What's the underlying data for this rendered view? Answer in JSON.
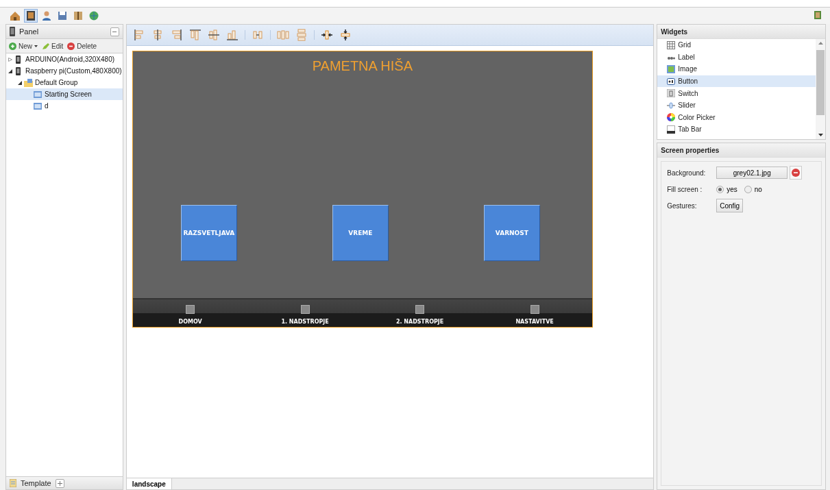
{
  "app_toolbar": {
    "tools": [
      {
        "kind": "home",
        "selected": false
      },
      {
        "kind": "device",
        "selected": true
      },
      {
        "kind": "user",
        "selected": false
      },
      {
        "kind": "save",
        "selected": false
      },
      {
        "kind": "book",
        "selected": false
      },
      {
        "kind": "globe",
        "selected": false
      }
    ]
  },
  "panel": {
    "title": "Panel",
    "actions": [
      {
        "kind": "new",
        "label": "New"
      },
      {
        "kind": "edit",
        "label": "Edit"
      },
      {
        "kind": "delete",
        "label": "Delete"
      }
    ],
    "tree": [
      {
        "kind": "device",
        "label": "ARDUINO(Android,320X480)",
        "expanded": false,
        "selected": false
      },
      {
        "kind": "device",
        "label": "Raspberry pi(Custom,480X800)",
        "expanded": true,
        "selected": false,
        "children": [
          {
            "kind": "group",
            "label": "Default Group",
            "expanded": true,
            "selected": false,
            "children": [
              {
                "kind": "screen",
                "label": "Starting Screen",
                "selected": true
              },
              {
                "kind": "screen",
                "label": "d",
                "selected": false
              }
            ]
          }
        ]
      }
    ],
    "footer": "Template"
  },
  "align_toolbar": {
    "tools": [
      {
        "kind": "alignleft"
      },
      {
        "kind": "aligncenter"
      },
      {
        "kind": "alignright"
      },
      {
        "kind": "aligntop"
      },
      {
        "kind": "alignmiddle"
      },
      {
        "kind": "alignbottom"
      },
      {
        "kind": "separator"
      },
      {
        "kind": "spacing"
      },
      {
        "kind": "separator"
      },
      {
        "kind": "distributeh"
      },
      {
        "kind": "distributev"
      },
      {
        "kind": "separator"
      },
      {
        "kind": "fitwidth"
      },
      {
        "kind": "fitheight"
      }
    ]
  },
  "canvas": {
    "title": "PAMETNA HIŠA",
    "buttons": [
      "RAZSVETLJAVA",
      "VREME",
      "VARNOST"
    ],
    "tab_bar": [
      "DOMOV",
      "1. NADSTROPJE",
      "2. NADSTROPJE",
      "NASTAVITVE"
    ]
  },
  "editor_tabs": [
    {
      "label": "landscape",
      "selected": true
    }
  ],
  "widgets": {
    "title": "Widgets",
    "items": [
      {
        "kind": "grid",
        "label": "Grid",
        "selected": false
      },
      {
        "kind": "label",
        "label": "Label",
        "selected": false
      },
      {
        "kind": "image",
        "label": "Image",
        "selected": false
      },
      {
        "kind": "button",
        "label": "Button",
        "selected": true
      },
      {
        "kind": "switch",
        "label": "Switch",
        "selected": false
      },
      {
        "kind": "slider",
        "label": "Slider",
        "selected": false
      },
      {
        "kind": "color",
        "label": "Color Picker",
        "selected": false
      },
      {
        "kind": "tabbar",
        "label": "Tab Bar",
        "selected": false
      }
    ]
  },
  "screen_properties": {
    "title": "Screen properties",
    "background_label": "Background:",
    "background_value": "grey02.1.jpg",
    "fill_label": "Fill screen :",
    "fill_options": [
      {
        "label": "yes",
        "selected": true
      },
      {
        "label": "no",
        "selected": false
      }
    ],
    "gestures_label": "Gestures:",
    "gestures_button": "Config"
  }
}
